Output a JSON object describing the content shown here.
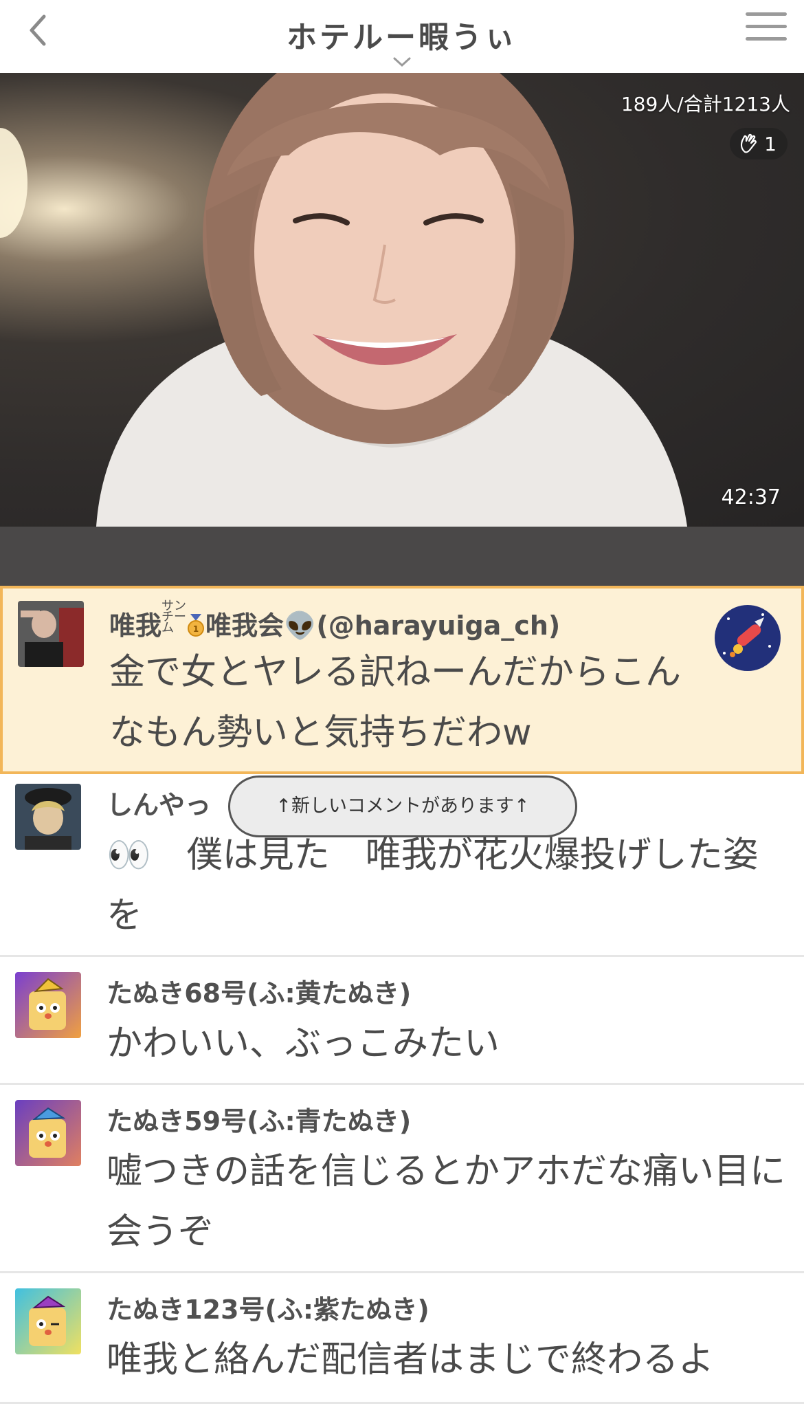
{
  "header": {
    "title": "ホテルー暇うぃ",
    "back_icon": "chevron-left-icon",
    "menu_icon": "hamburger-menu-icon",
    "title_dropdown_icon": "chevron-down-icon"
  },
  "video": {
    "viewer_count": "189人/合計1213人",
    "clap_count": "1",
    "elapsed_time": "42:37"
  },
  "new_comment_banner": "↑新しいコメントがあります↑",
  "comments": [
    {
      "name_main": "唯我",
      "name_small": "サン チーム",
      "name_rest": "唯我会👽(@harayuiga_ch)",
      "text": "金で女とヤレる訳ねーんだからこんなもん勢いと気持ちだわw",
      "highlighted": true,
      "gift_icon": "rocket-firework-icon"
    },
    {
      "name": "しんやっ",
      "text": "👀　僕は見た　唯我が花火爆投げした姿を"
    },
    {
      "name": "たぬき68号(ふ:黄たぬき)",
      "text": "かわいい、ぶっこみたい"
    },
    {
      "name": "たぬき59号(ふ:青たぬき)",
      "text": "嘘つきの話を信じるとかアホだな痛い目に会うぞ"
    },
    {
      "name": "たぬき123号(ふ:紫たぬき)",
      "text": "唯我と絡んだ配信者はまじで終わるよ"
    }
  ],
  "colors": {
    "highlight_bg": "#fdf1d6",
    "highlight_border": "#f2b659",
    "tanuki_yellow": "#f0c23a",
    "tanuki_blue": "#4a9be0",
    "tanuki_purple": "#9a3fc0"
  }
}
